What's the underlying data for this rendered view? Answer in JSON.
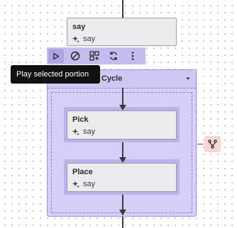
{
  "say_node": {
    "title": "say",
    "subtitle": "say"
  },
  "toolbar": {
    "buttons": [
      {
        "name": "play-selected-button",
        "icon": "play-outline-icon"
      },
      {
        "name": "disable-button",
        "icon": "ban-icon"
      },
      {
        "name": "group-button",
        "icon": "grid-add-icon"
      },
      {
        "name": "loop-button",
        "icon": "sync-icon"
      },
      {
        "name": "more-button",
        "icon": "more-vertical-icon"
      }
    ],
    "tooltip": "Play selected portion"
  },
  "loop_group": {
    "title": "Cycle",
    "collapse_icon": "caret-down-icon",
    "nodes": [
      {
        "title": "Pick",
        "subtitle": "say"
      },
      {
        "title": "Place",
        "subtitle": "say"
      }
    ]
  },
  "branch_button": {
    "icon": "branch-icon"
  },
  "colors": {
    "group_fill": "#d7cff7",
    "group_border": "#a091de",
    "node_fill": "#ecebee",
    "tooltip_bg": "#111111",
    "branch_fill": "#f7d6d6",
    "accent": "#b1a2e6"
  }
}
